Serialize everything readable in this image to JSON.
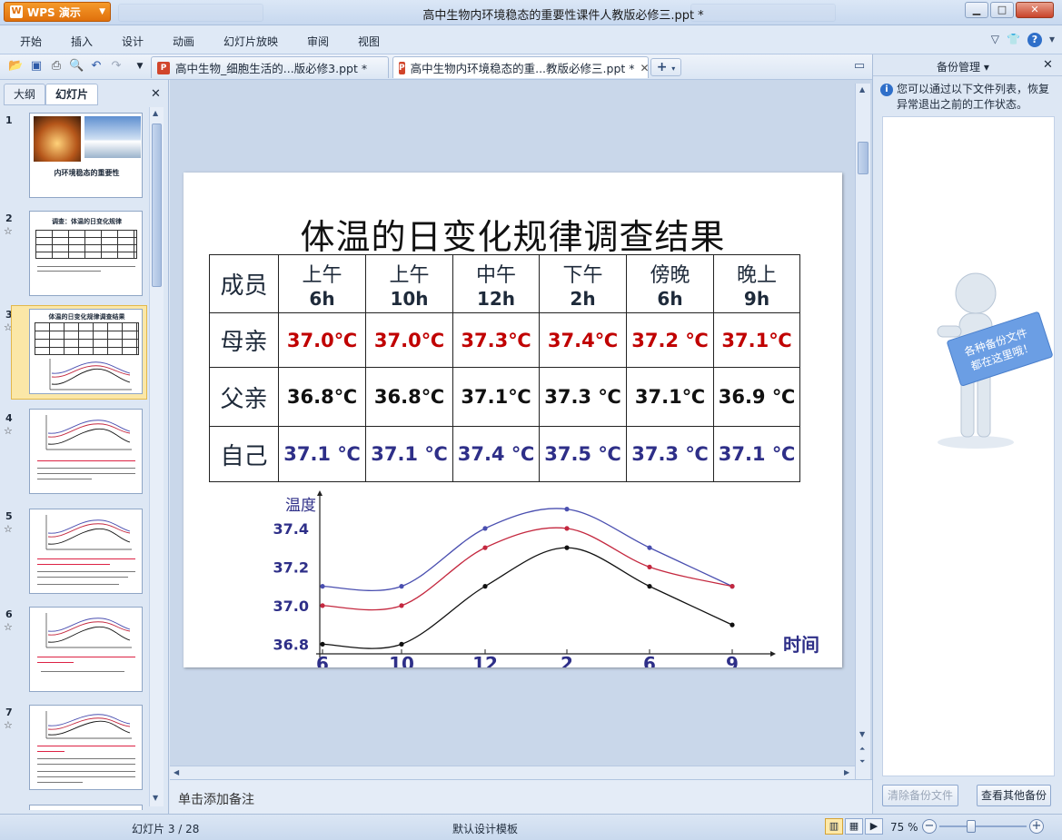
{
  "app": {
    "button_label": "WPS 演示",
    "window_title": "高中生物内环境稳态的重要性课件人教版必修三.ppt *"
  },
  "menu": [
    "开始",
    "插入",
    "设计",
    "动画",
    "幻灯片放映",
    "审阅",
    "视图"
  ],
  "doc_tabs": [
    {
      "label": "高中生物_细胞生活的...版必修3.ppt *",
      "active": false
    },
    {
      "label": "高中生物内环境稳态的重...教版必修三.ppt *",
      "active": true
    }
  ],
  "left_panel": {
    "tabs": [
      "大纲",
      "幻灯片"
    ],
    "active_tab": "幻灯片",
    "slides": [
      {
        "num": "1",
        "title": "内环境稳态的重要性"
      },
      {
        "num": "2",
        "title": "调查：体温的日变化规律"
      },
      {
        "num": "3",
        "title": "体温的日变化规律调查结果"
      },
      {
        "num": "4",
        "title": ""
      },
      {
        "num": "5",
        "title": ""
      },
      {
        "num": "6",
        "title": ""
      },
      {
        "num": "7",
        "title": ""
      }
    ],
    "selected_slide": 3
  },
  "slide": {
    "title": "体温的日变化规律调查结果",
    "table": {
      "corner": "成员",
      "columns": [
        {
          "l1": "上午",
          "l2": "6h"
        },
        {
          "l1": "上午",
          "l2": "10h"
        },
        {
          "l1": "中午",
          "l2": "12h"
        },
        {
          "l1": "下午",
          "l2": "2h"
        },
        {
          "l1": "傍晚",
          "l2": "6h"
        },
        {
          "l1": "晚上",
          "l2": "9h"
        }
      ],
      "rows": [
        {
          "member": "母亲",
          "color": "red",
          "values": [
            "37.0℃",
            "37.0℃",
            "37.3℃",
            "37.4℃",
            "37.2 ℃",
            "37.1℃"
          ]
        },
        {
          "member": "父亲",
          "color": "black",
          "values": [
            "36.8℃",
            "36.8℃",
            "37.1℃",
            "37.3 ℃",
            "37.1℃",
            "36.9 ℃"
          ]
        },
        {
          "member": "自己",
          "color": "blue",
          "values": [
            "37.1 ℃",
            "37.1 ℃",
            "37.4 ℃",
            "37.5 ℃",
            "37.3 ℃",
            "37.1 ℃"
          ]
        }
      ]
    }
  },
  "chart_data": {
    "type": "line",
    "ylabel": "温度",
    "xlabel": "时间",
    "categories": [
      "6",
      "10",
      "12",
      "2",
      "6",
      "9"
    ],
    "y_ticks": [
      "36.8",
      "37.0",
      "37.2",
      "37.4"
    ],
    "ylim": [
      36.75,
      37.55
    ],
    "grid": false,
    "series": [
      {
        "values": [
          37.1,
          37.1,
          37.4,
          37.5,
          37.3,
          37.1
        ],
        "color": "#4a4fb0"
      },
      {
        "values": [
          37.0,
          37.0,
          37.3,
          37.4,
          37.2,
          37.1
        ],
        "color": "#c4283f"
      },
      {
        "values": [
          36.8,
          36.8,
          37.1,
          37.3,
          37.1,
          36.9
        ],
        "color": "#111111"
      }
    ]
  },
  "notes_placeholder": "单击添加备注",
  "right_panel": {
    "title": "备份管理",
    "info": "您可以通过以下文件列表，恢复异常退出之前的工作状态。",
    "figure_text": "各种备份文件都在这里哦！",
    "btn_clear": "清除备份文件",
    "btn_view": "查看其他备份"
  },
  "status": {
    "slide_counter": "幻灯片 3 / 28",
    "template": "默认设计模板",
    "zoom": "75 %",
    "zoom_level_percent": 75
  }
}
